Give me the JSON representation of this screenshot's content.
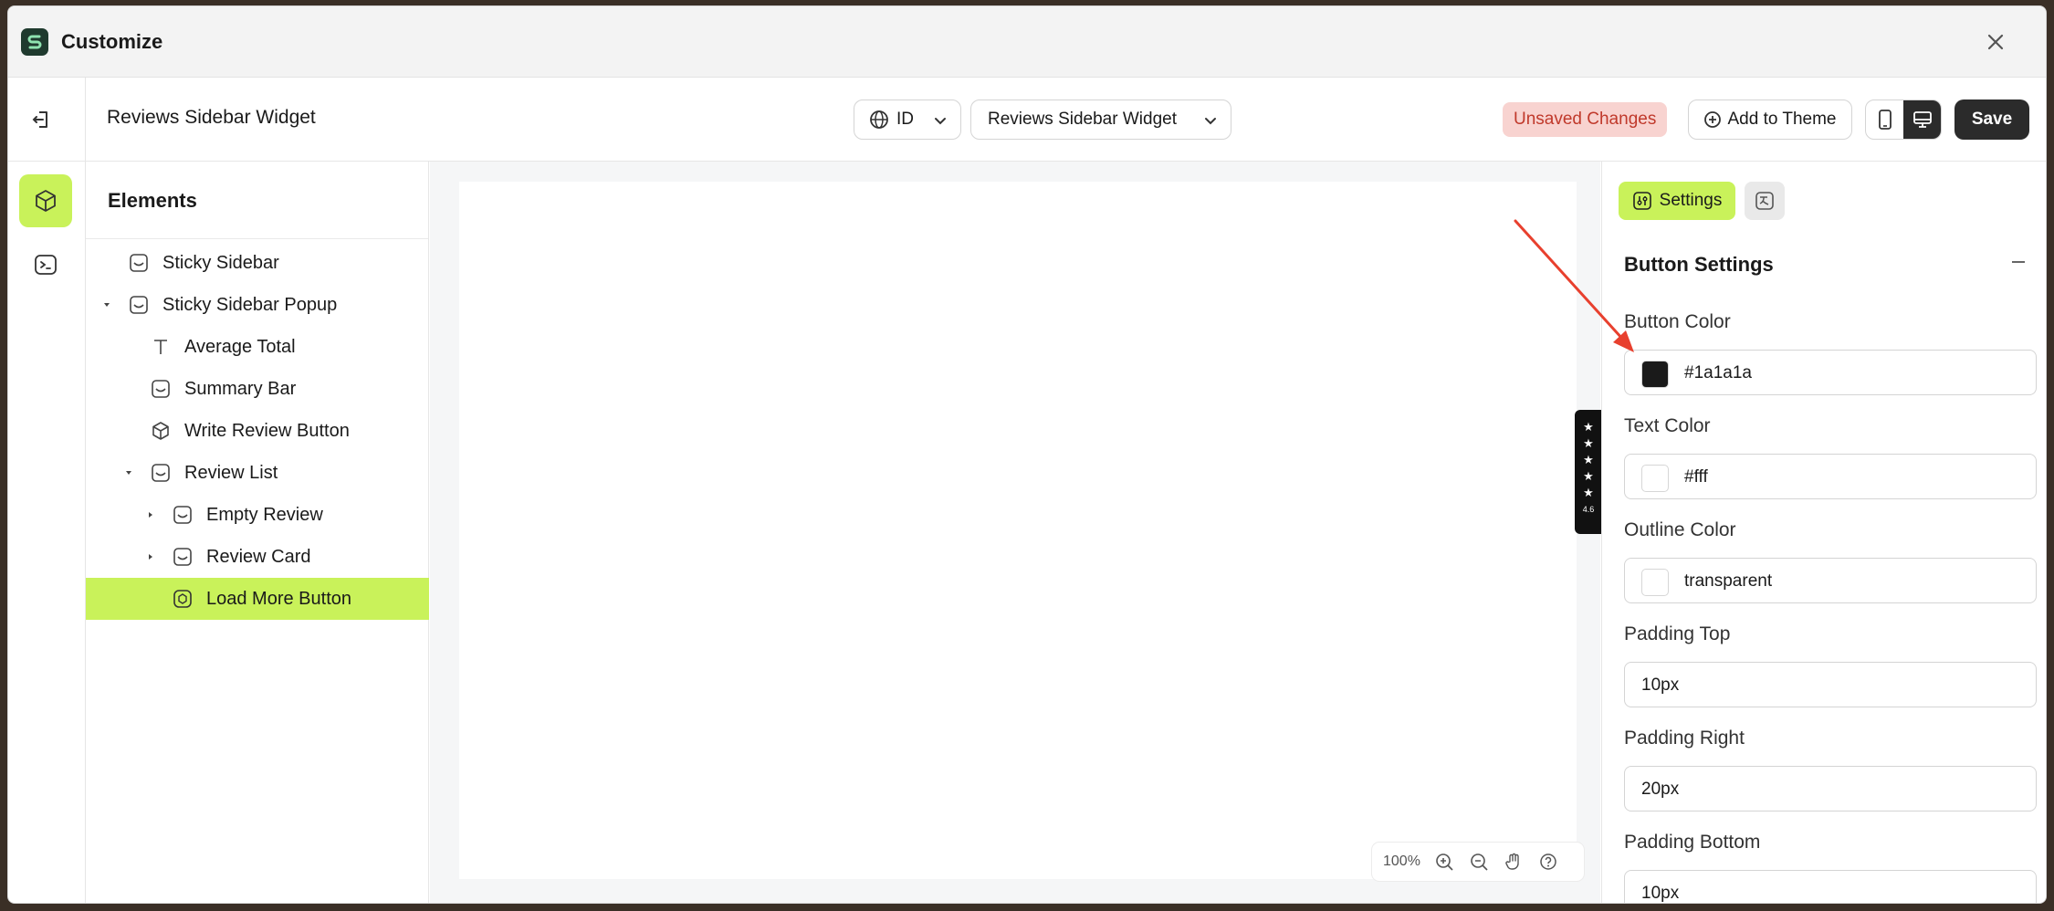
{
  "window": {
    "title": "Customize"
  },
  "header": {
    "page_name": "Reviews Sidebar Widget",
    "language": "ID",
    "widget_select": "Reviews Sidebar Widget",
    "unsaved_badge": "Unsaved Changes",
    "add_to_theme": "Add to Theme",
    "save": "Save"
  },
  "elements_panel": {
    "title": "Elements",
    "items": [
      {
        "label": "Sticky Sidebar"
      },
      {
        "label": "Sticky Sidebar Popup"
      },
      {
        "label": "Average Total"
      },
      {
        "label": "Summary Bar"
      },
      {
        "label": "Write Review Button"
      },
      {
        "label": "Review List"
      },
      {
        "label": "Empty Review"
      },
      {
        "label": "Review Card"
      },
      {
        "label": "Load More Button"
      }
    ]
  },
  "canvas": {
    "rating": "4.6",
    "zoom": "100%"
  },
  "settings": {
    "tab_settings": "Settings",
    "section_title": "Button Settings",
    "fields": {
      "button_color": {
        "label": "Button Color",
        "value": "#1a1a1a",
        "swatch": "#1a1a1a"
      },
      "text_color": {
        "label": "Text Color",
        "value": "#fff",
        "swatch": "#ffffff"
      },
      "outline_color": {
        "label": "Outline Color",
        "value": "transparent",
        "swatch": "#ffffff"
      },
      "padding_top": {
        "label": "Padding Top",
        "value": "10px"
      },
      "padding_right": {
        "label": "Padding Right",
        "value": "20px"
      },
      "padding_bottom": {
        "label": "Padding Bottom",
        "value": "10px"
      }
    }
  },
  "colors": {
    "accent": "#c9f25a",
    "dark": "#2b2b2b",
    "annotation_arrow": "#e8402e"
  }
}
